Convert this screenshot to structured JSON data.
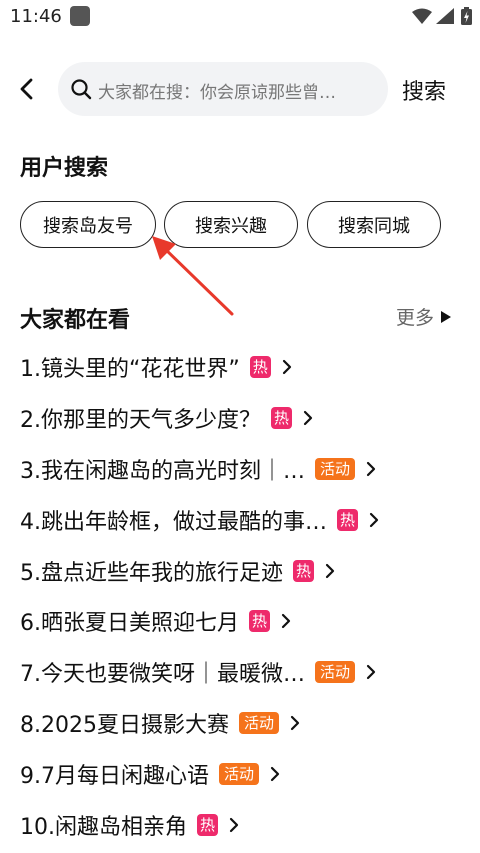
{
  "status_bar": {
    "time": "11:46"
  },
  "search": {
    "placeholder": "大家都在搜：你会原谅那些曾…",
    "submit_label": "搜索"
  },
  "user_search": {
    "title": "用户搜索",
    "chips": [
      "搜索岛友号",
      "搜索兴趣",
      "搜索同城"
    ]
  },
  "trending": {
    "title": "大家都在看",
    "more_label": "更多",
    "items": [
      {
        "title": "1.镜头里的“花花世界”",
        "badge": "热",
        "badge_type": "hot"
      },
      {
        "title": "2.你那里的天气多少度？",
        "badge": "热",
        "badge_type": "hot"
      },
      {
        "title": "3.我在闲趣岛的高光时刻｜…",
        "badge": "活动",
        "badge_type": "activity"
      },
      {
        "title": "4.跳出年龄框，做过最酷的事…",
        "badge": "热",
        "badge_type": "hot"
      },
      {
        "title": "5.盘点近些年我的旅行足迹",
        "badge": "热",
        "badge_type": "hot"
      },
      {
        "title": "6.晒张夏日美照迎七月",
        "badge": "热",
        "badge_type": "hot"
      },
      {
        "title": "7.今天也要微笑呀｜最暖微…",
        "badge": "活动",
        "badge_type": "activity"
      },
      {
        "title": "8.2025夏日摄影大赛",
        "badge": "活动",
        "badge_type": "activity"
      },
      {
        "title": "9.7月每日闲趣心语",
        "badge": "活动",
        "badge_type": "activity"
      },
      {
        "title": "10.闲趣岛相亲角",
        "badge": "热",
        "badge_type": "hot"
      }
    ]
  },
  "colors": {
    "hot_badge": "#ee2a6b",
    "activity_badge": "#f5731b",
    "annotation_arrow": "#e8392b",
    "search_bg": "#f2f3f5"
  }
}
